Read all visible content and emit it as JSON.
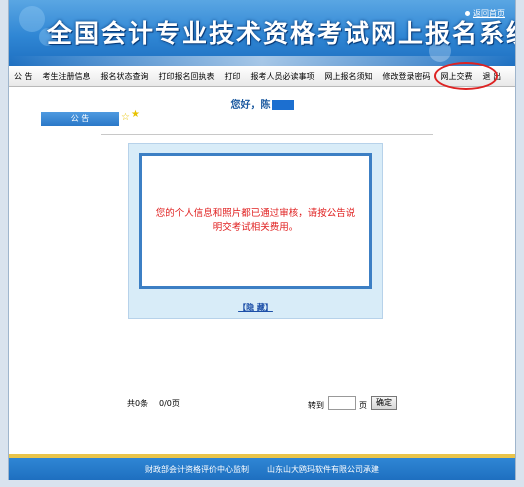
{
  "header": {
    "title": "全国会计专业技术资格考试网上报名系统",
    "home_link": "返回首页"
  },
  "nav": {
    "items": [
      "公 告",
      "考生注册信息",
      "报名状态查询",
      "打印报名回执表",
      "打印",
      "报考人员必读事项",
      "网上报名须知",
      "修改登录密码",
      "网上交费",
      "退 出"
    ]
  },
  "greeting": {
    "text": "您好，陈"
  },
  "notice": {
    "tab_label": "公 告"
  },
  "message": {
    "text": "您的个人信息和照片都已通过审核，请按公告说明交考试相关费用。",
    "hide_link": "【隐 藏】"
  },
  "pagination": {
    "count": "共0条",
    "pages": "0/0页",
    "goto_label": "转到",
    "page_label": "页",
    "goto_value": "",
    "confirm_label": "确定"
  },
  "footer": {
    "supervisor": "财政部会计资格评价中心监制",
    "developer": "山东山大鸥玛软件有限公司承建"
  },
  "colors": {
    "accent": "#2f86d4",
    "annotation_circle": "#d22222"
  }
}
